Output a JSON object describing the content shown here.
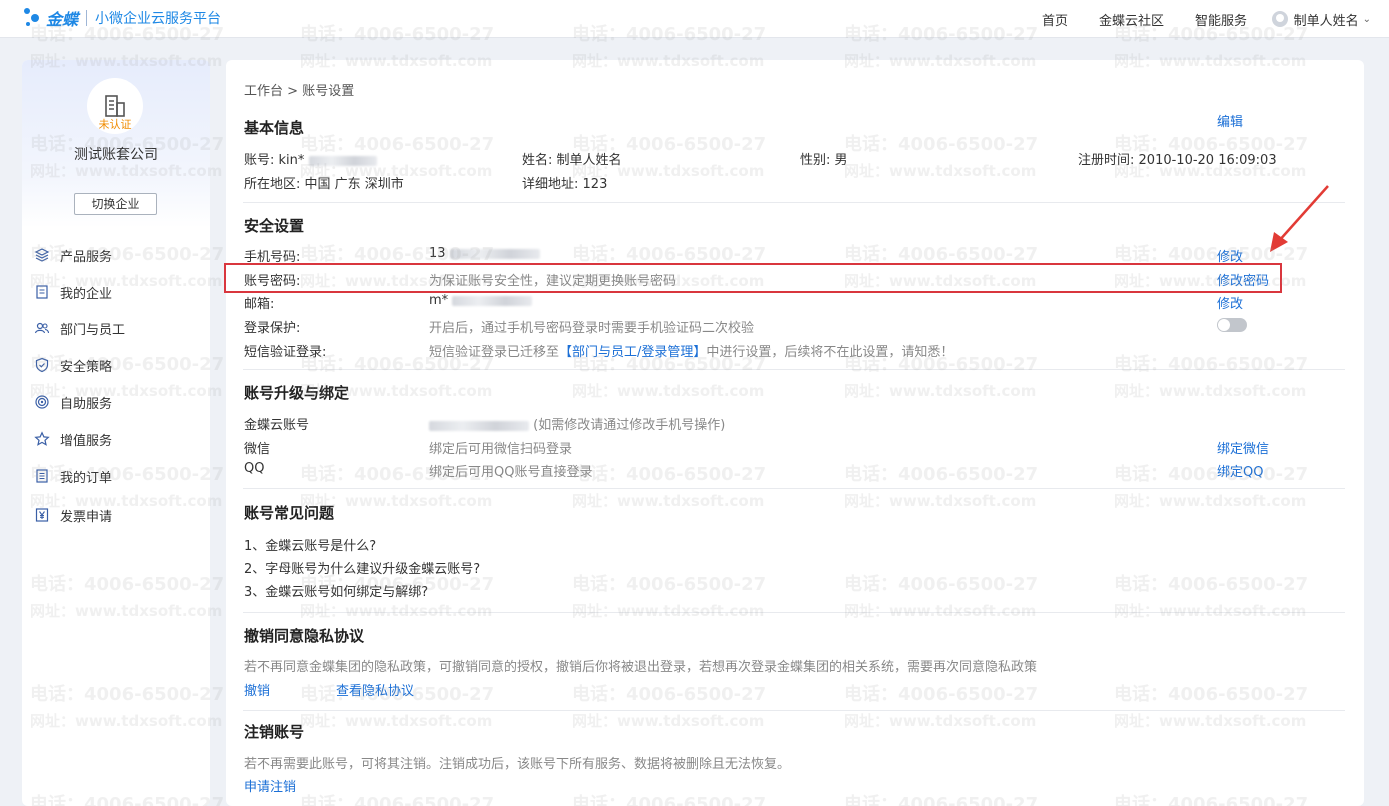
{
  "topbar": {
    "brand": "金蝶",
    "subtitle": "小微企业云服务平台",
    "nav": [
      {
        "label": "首页"
      },
      {
        "label": "金蝶云社区"
      },
      {
        "label": "智能服务"
      }
    ],
    "user_name": "制单人姓名"
  },
  "sidebar": {
    "cert_badge": "未认证",
    "company_name": "测试账套公司",
    "switch_label": "切换企业",
    "items": [
      {
        "label": "产品服务",
        "icon": "layers-icon"
      },
      {
        "label": "我的企业",
        "icon": "document-icon"
      },
      {
        "label": "部门与员工",
        "icon": "users-icon"
      },
      {
        "label": "安全策略",
        "icon": "shield-icon"
      },
      {
        "label": "自助服务",
        "icon": "target-icon"
      },
      {
        "label": "增值服务",
        "icon": "star-icon"
      },
      {
        "label": "我的订单",
        "icon": "list-icon"
      },
      {
        "label": "发票申请",
        "icon": "yen-icon"
      }
    ]
  },
  "breadcrumb": {
    "root": "工作台",
    "sep": ">",
    "current": "账号设置"
  },
  "basic": {
    "title": "基本信息",
    "edit_label": "编辑",
    "account_label": "账号:",
    "account_value": "kin*",
    "name_label": "姓名:",
    "name_value": "制单人姓名",
    "gender_label": "性别:",
    "gender_value": "男",
    "reg_label": "注册时间:",
    "reg_value": "2010-10-20 16:09:03",
    "region_label": "所在地区:",
    "region_value": "中国 广东 深圳市",
    "address_label": "详细地址:",
    "address_value": "123"
  },
  "security": {
    "title": "安全设置",
    "phone_label": "手机号码:",
    "phone_value": "13",
    "phone_action": "修改",
    "password_label": "账号密码:",
    "password_desc": "为保证账号安全性，建议定期更换账号密码",
    "password_action": "修改密码",
    "email_label": "邮箱:",
    "email_value": "m*",
    "email_action": "修改",
    "login_protect_label": "登录保护:",
    "login_protect_desc": "开启后，通过手机号密码登录时需要手机验证码二次校验",
    "sms_label": "短信验证登录:",
    "sms_desc_prefix": "短信验证登录已迁移至",
    "sms_link": "【部门与员工/登录管理】",
    "sms_desc_suffix": "中进行设置，后续将不在此设置，请知悉！"
  },
  "binding": {
    "title": "账号升级与绑定",
    "kd_label": "金蝶云账号",
    "kd_note": "(如需修改请通过修改手机号操作)",
    "wechat_label": "微信",
    "wechat_desc": "绑定后可用微信扫码登录",
    "wechat_action": "绑定微信",
    "qq_label": "QQ",
    "qq_desc": "绑定后可用QQ账号直接登录",
    "qq_action": "绑定QQ"
  },
  "faq": {
    "title": "账号常见问题",
    "items": [
      "1、金蝶云账号是什么?",
      "2、字母账号为什么建议升级金蝶云账号?",
      "3、金蝶云账号如何绑定与解绑?"
    ]
  },
  "privacy": {
    "title": "撤销同意隐私协议",
    "desc": "若不再同意金蝶集团的隐私政策，可撤销同意的授权，撤销后你将被退出登录，若想再次登录金蝶集团的相关系统，需要再次同意隐私政策",
    "revoke": "撤销",
    "view": "查看隐私协议"
  },
  "cancel": {
    "title": "注销账号",
    "desc": "若不再需要此账号，可将其注销。注销成功后，该账号下所有服务、数据将被删除且无法恢复。",
    "action": "申请注销"
  },
  "watermark": {
    "phone": "电话：4006-6500-27",
    "site": "网址：www.tdxsoft.com"
  },
  "colors": {
    "accent": "#1b6fd6",
    "highlight": "#d9363e",
    "badge": "#f08c00"
  }
}
